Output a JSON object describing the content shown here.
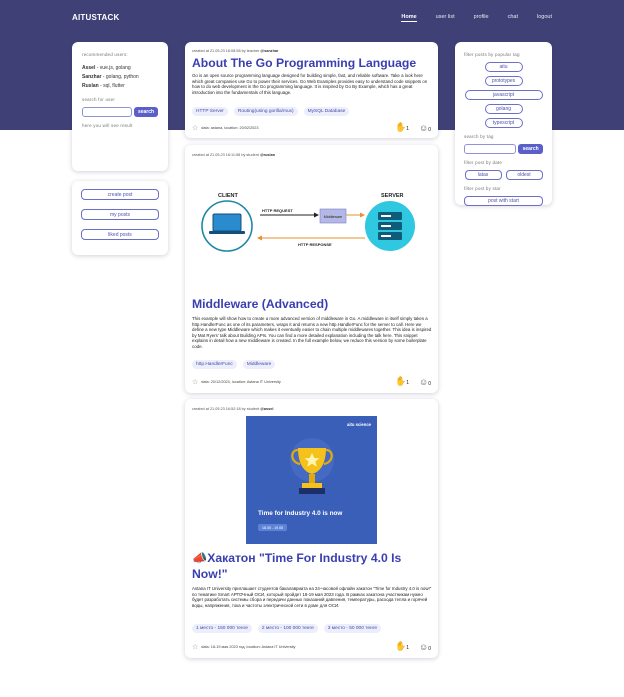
{
  "nav": {
    "brand": "AITUSTACK",
    "links": [
      "Home",
      "user list",
      "profile",
      "chat",
      "logout"
    ]
  },
  "left_sidebar": {
    "heading": "recommended users:",
    "users": [
      {
        "name": "Assel",
        "skills": "- vue.js, golang"
      },
      {
        "name": "Sanzhar",
        "skills": "- golang, python"
      },
      {
        "name": "Ruslan",
        "skills": "- sql, flutter"
      }
    ],
    "search_label": "search for user",
    "search_button": "search",
    "search_result": "here you will see result",
    "actions": [
      "create post",
      "my posts",
      "liked posts"
    ]
  },
  "right_sidebar": {
    "tags_heading": "filter posts by popular tag",
    "tags": [
      "aitu",
      "prototypes",
      "javascript",
      "golang",
      "typescript"
    ],
    "search_tag_label": "search by tag",
    "search_button": "search",
    "date_heading": "filter post by date",
    "date_buttons": [
      "latas",
      "oldest"
    ],
    "star_heading": "filter post by star",
    "star_button": "post with start"
  },
  "posts": [
    {
      "meta_prefix": "created at 21.05.23 16:08:58 by",
      "role": "teacher",
      "author": "@sanzhar",
      "title": "About The Go Programming Language",
      "body": "Go is an open source programming language designed for building simple, fast, and reliable software. Take a look here which great companies use Go to power their services. Go Web Examples provides easy to understand code snippets on how to do web development in the Go programming language. It is inspired by Go By Example, which has a great introduction into the fundamentals of this language.",
      "tags": [
        "HTTP Server",
        "Routing(using gorilla/mux)",
        "MySQL Database"
      ],
      "footer": "data: astana, location: 20/02/2023",
      "count_a": "1",
      "count_b": "0"
    },
    {
      "meta_prefix": "created at 21.05.23 16:11:58 by",
      "role": "student",
      "author": "@ruslan",
      "diagram": {
        "client": "CLIENT",
        "server": "SERVER",
        "request": "HTTP REQUEST",
        "response": "HTTP RESPONSE",
        "middleware": "Middleware"
      },
      "title": "Middleware (Advanced)",
      "body": "This example will show how to create a more advanced version of middleware in Go. A middleware in itself simply takes a http.HandlerFunc as one of its parameters, wraps it and returns a new http.HandlerFunc for the server to call. Here we define a new type Middleware which makes it eventually easier to chain multiple middlewares together. This idea is inspired by Mat Ryers' talk about Building APIs. You can find a more detailed explanation including the talk here. This snippet explains in detail how a new middleware is created. In the full example below, we reduce this version by some boilerplate code.",
      "tags": [
        "http.HandlerFunc",
        "Middleware"
      ],
      "footer": "data: 20/12/2024, location: Astana IT University",
      "count_a": "1",
      "count_b": "0"
    },
    {
      "meta_prefix": "created at 21.05.23 16:52:18 by",
      "role": "student",
      "author": "@assel",
      "poster": {
        "logo": "aitu science",
        "headline": "Time for Industry 4.0 is now",
        "dates": "18.05 - 19.05"
      },
      "title": "Хакатон \"Time For Industry 4.0 Is Now!\"",
      "title_emoji": "📣",
      "body": "Astana IT University приглашает студентов бакалавриата на 24-часовой офлайн хакатон \"Time for Industry 4.0 is now!\" по тематике Smart АРТОЧный ОСИ, который пройдет 18-19 мая 2023 года. В рамках хакатона участникам нужно будет разработать системы сбора и передачи данных показаний давления, температуры, расхода тепла и горячей воды, напряжения, тока и частоты электрической сети в доме для ОСИ.",
      "tags": [
        "1 место - 150 000 тенге",
        "2 место - 100 000 тенге",
        "3 место - 50 000 тенге"
      ],
      "footer": "data: 18-19 мая 2023 год, location: Astana IT University",
      "count_a": "1",
      "count_b": "0"
    }
  ]
}
